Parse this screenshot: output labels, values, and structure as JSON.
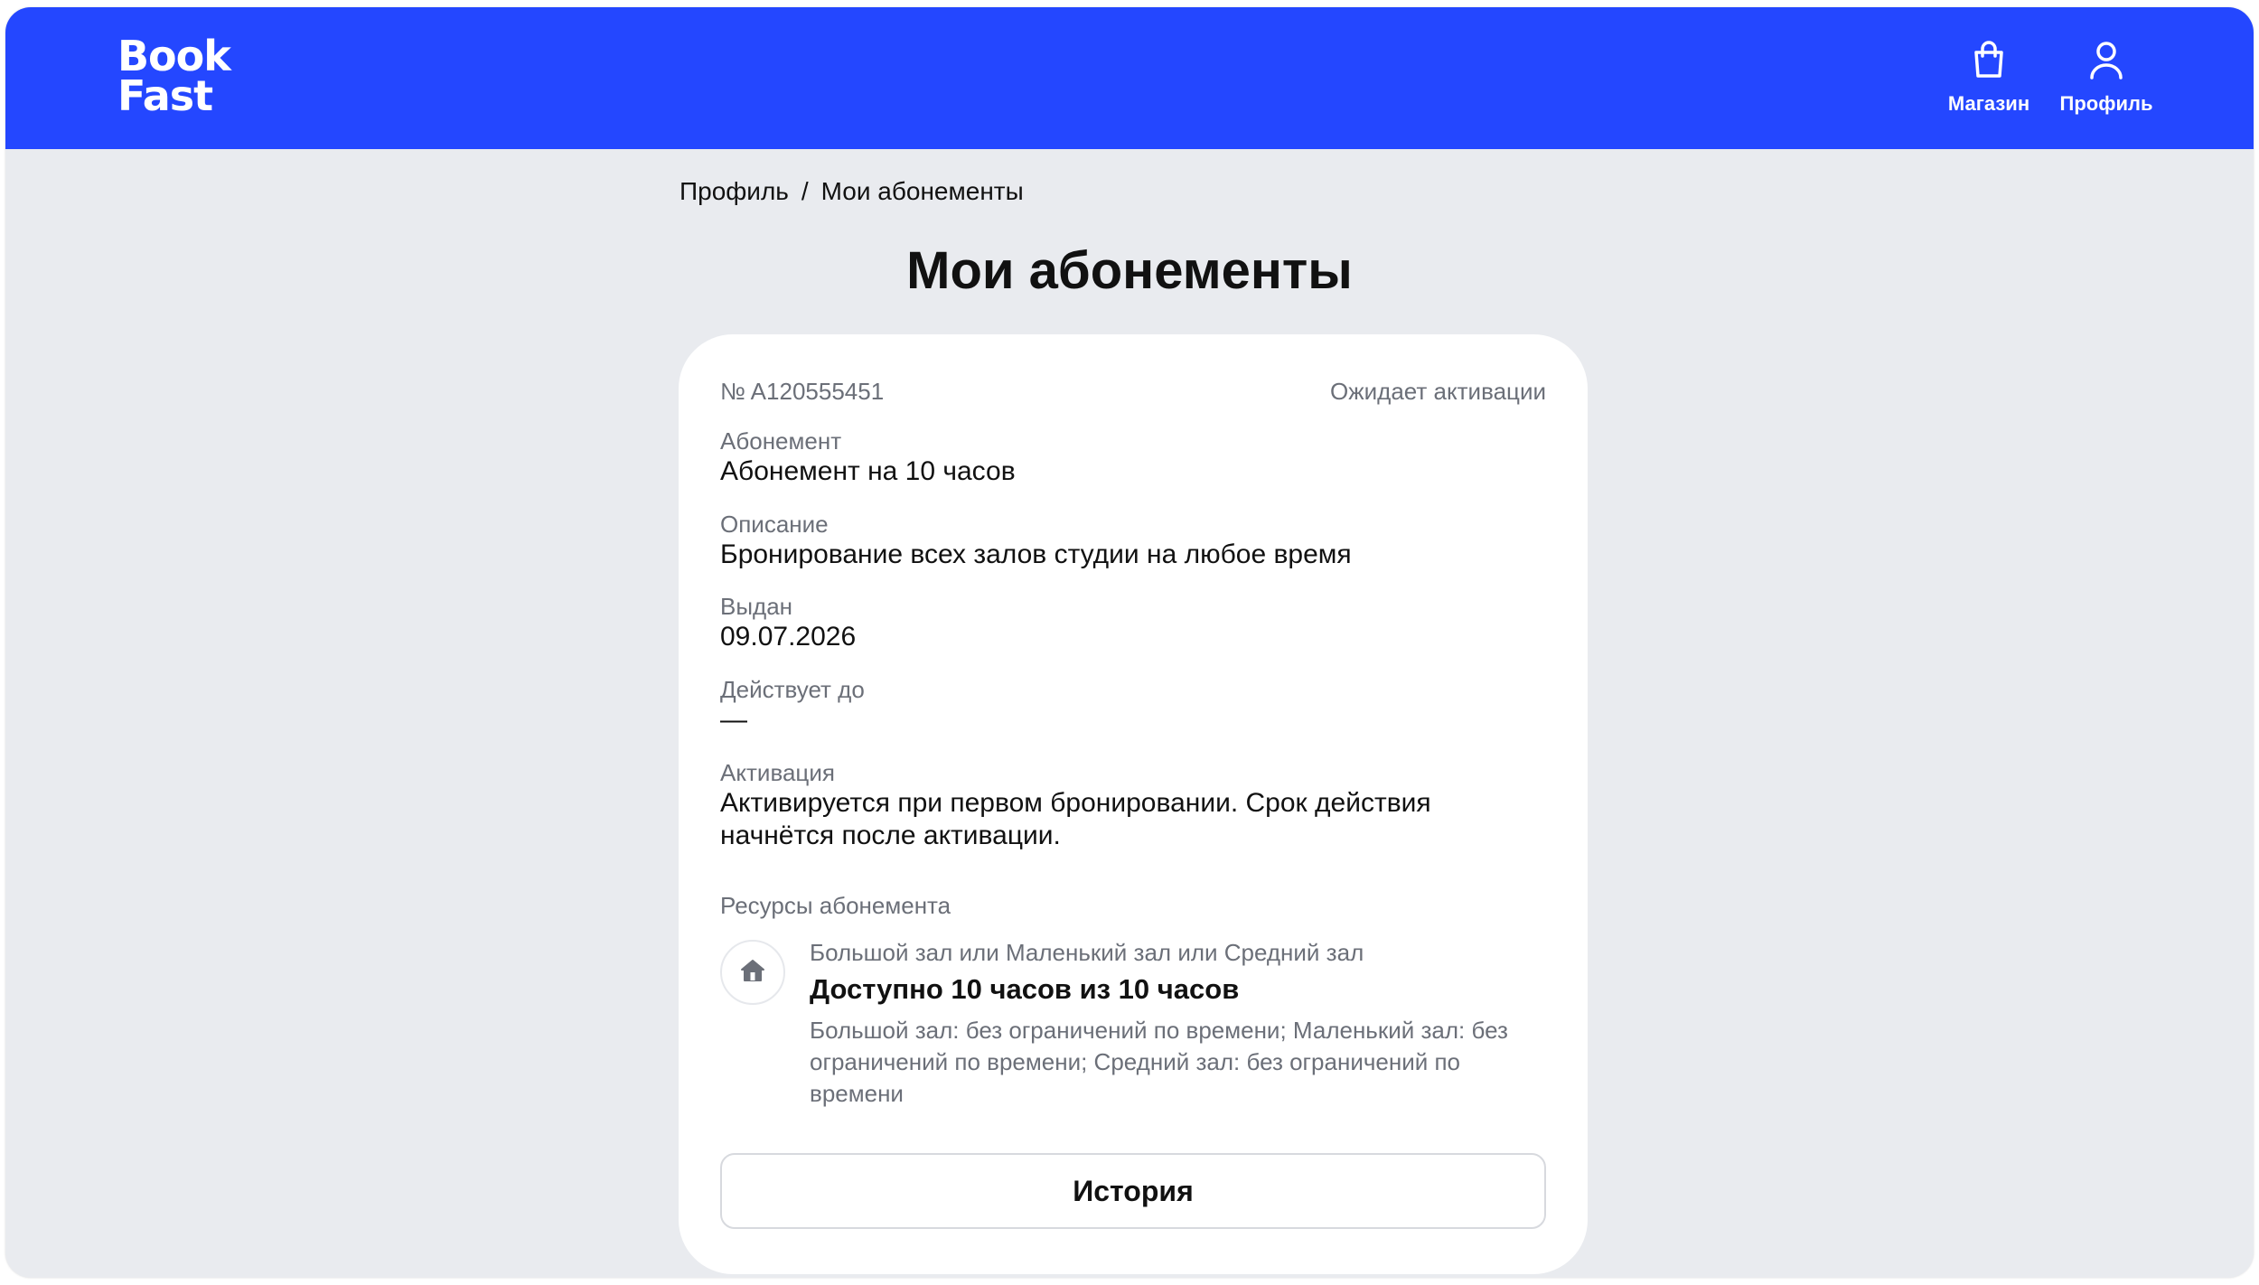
{
  "header": {
    "logo_line1": "Book",
    "logo_line2": "Fast",
    "brand_color": "#2447ff",
    "nav": [
      {
        "label": "Магазин",
        "icon": "shopping-bag-icon"
      },
      {
        "label": "Профиль",
        "icon": "user-icon"
      }
    ]
  },
  "breadcrumb": {
    "items": [
      "Профиль",
      "Мои абонементы"
    ],
    "separator": "/"
  },
  "page_title": "Мои абонементы",
  "subscription": {
    "number": "№ A120555451",
    "status": "Ожидает активации",
    "fields": [
      {
        "label": "Абонемент",
        "value": "Абонемент на 10 часов"
      },
      {
        "label": "Описание",
        "value": "Бронирование всех залов студии на любое время"
      },
      {
        "label": "Выдан",
        "value": "09.07.2026"
      },
      {
        "label": "Действует до",
        "value": "—"
      },
      {
        "label": "Активация",
        "value": "Активируется при первом бронировании. Срок действия начнётся после активации."
      }
    ],
    "resources_title": "Ресурсы абонемента",
    "resource": {
      "icon": "home-icon",
      "halls": "Большой зал или Маленький зал или Средний зал",
      "availability": "Доступно 10 часов из 10 часов",
      "details": "Большой зал: без ограничений по времени; Маленький зал: без ограничений по времени; Средний зал: без ограничений по времени"
    },
    "history_button": "История"
  }
}
